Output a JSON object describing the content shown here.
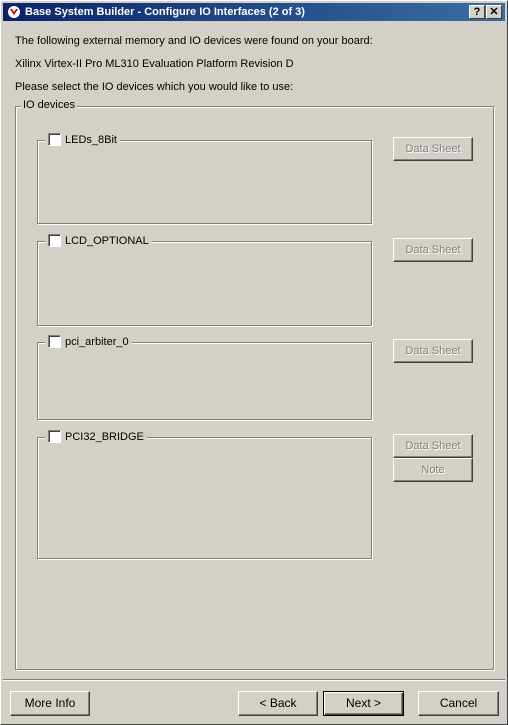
{
  "window": {
    "title": "Base System Builder - Configure IO Interfaces (2 of 3)",
    "help_label": "?",
    "close_label": "✕"
  },
  "intro": {
    "line1": "The following external memory and IO devices were found on your board:",
    "board": "Xilinx Virtex-II Pro ML310 Evaluation Platform Revision D",
    "prompt": "Please select the IO devices which you would like to use:"
  },
  "io_group": {
    "label": "IO devices",
    "devices": [
      {
        "name": "LEDs_8Bit",
        "checked": false,
        "datasheet_label": "Data Sheet"
      },
      {
        "name": "LCD_OPTIONAL",
        "checked": false,
        "datasheet_label": "Data Sheet"
      },
      {
        "name": "pci_arbiter_0",
        "checked": false,
        "datasheet_label": "Data Sheet"
      },
      {
        "name": "PCI32_BRIDGE",
        "checked": false,
        "datasheet_label": "Data Sheet",
        "note_label": "Note"
      }
    ]
  },
  "footer": {
    "more_info": "More Info",
    "back": "< Back",
    "next": "Next >",
    "cancel": "Cancel"
  }
}
